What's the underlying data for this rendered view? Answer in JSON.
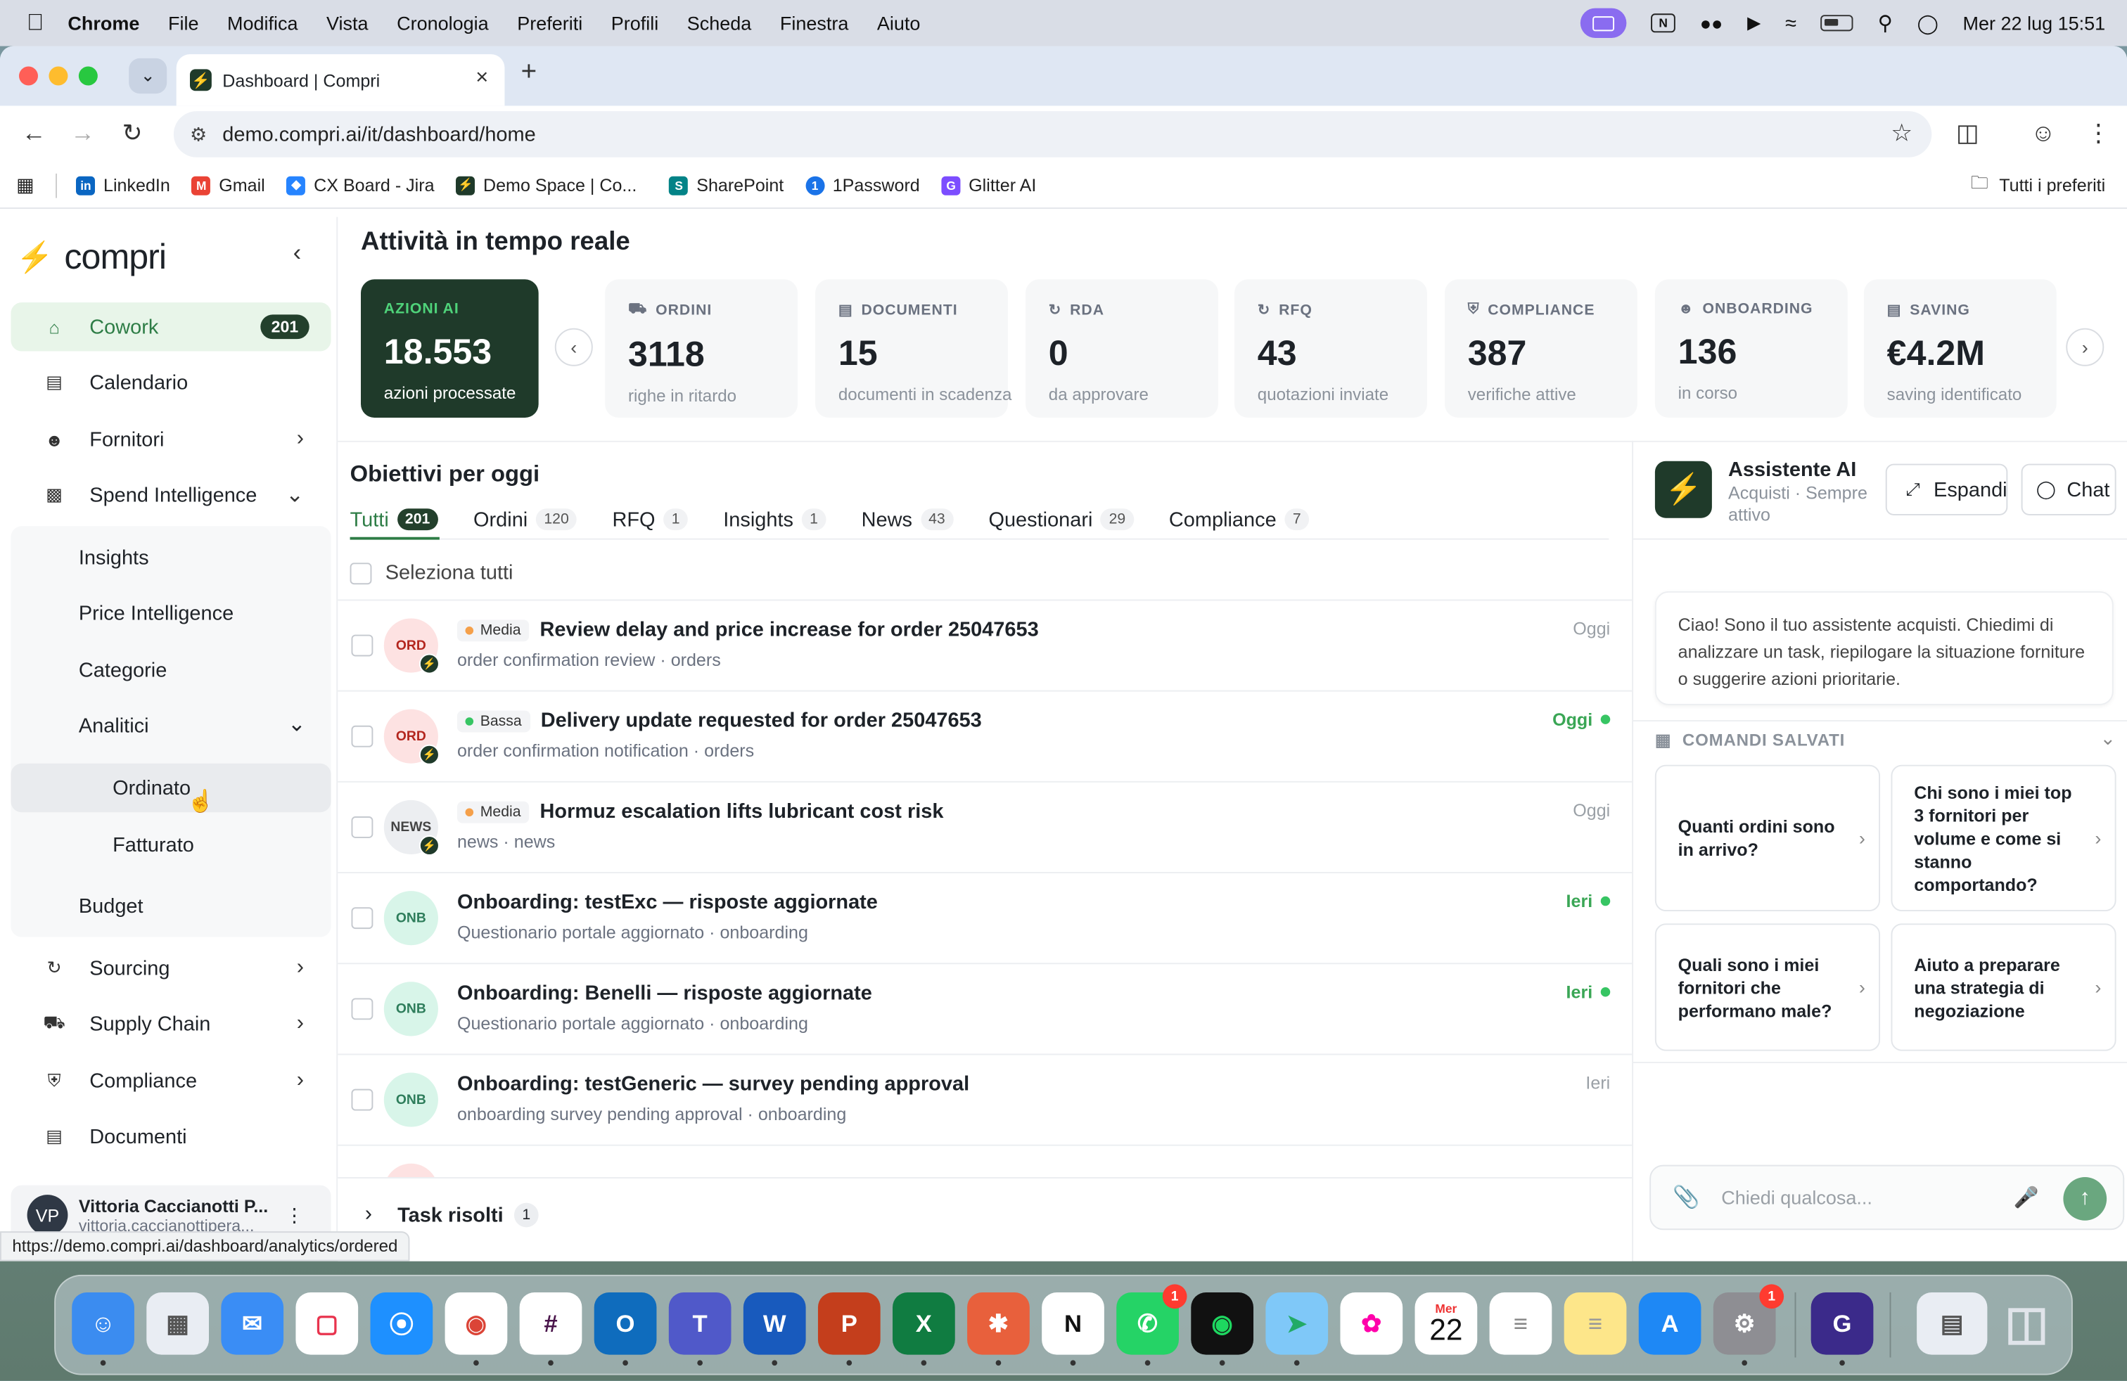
{
  "menubar": {
    "app": "Chrome",
    "items": [
      "File",
      "Modifica",
      "Vista",
      "Cronologia",
      "Preferiti",
      "Profili",
      "Scheda",
      "Finestra",
      "Aiuto"
    ],
    "clock": "Mer 22 lug  15:51"
  },
  "browser": {
    "tab_title": "Dashboard | Compri",
    "url": "demo.compri.ai/it/dashboard/home",
    "bookmarks": [
      "LinkedIn",
      "Gmail",
      "CX Board - Jira",
      "Demo Space | Co...",
      "SharePoint",
      "1Password",
      "Glitter AI"
    ],
    "all_bookmarks": "Tutti i preferiti",
    "status_url": "https://demo.compri.ai/dashboard/analytics/ordered"
  },
  "sidebar": {
    "brand": "compri",
    "cowork": {
      "label": "Cowork",
      "badge": "201"
    },
    "calendario": "Calendario",
    "fornitori": "Fornitori",
    "spend": "Spend Intelligence",
    "insights": "Insights",
    "price": "Price Intelligence",
    "categorie": "Categorie",
    "analitici": "Analitici",
    "ordinato": "Ordinato",
    "fatturato": "Fatturato",
    "budget": "Budget",
    "sourcing": "Sourcing",
    "supply": "Supply Chain",
    "compliance": "Compliance",
    "documenti": "Documenti",
    "user": {
      "initials": "VP",
      "name": "Vittoria Caccianotti P...",
      "email": "vittoria.caccianottipera..."
    }
  },
  "realtime": {
    "title": "Attività in tempo reale",
    "kpis": [
      {
        "label": "AZIONI AI",
        "value": "18.553",
        "caption": "azioni processate"
      },
      {
        "label": "ORDINI",
        "value": "3118",
        "caption": "righe in ritardo"
      },
      {
        "label": "DOCUMENTI",
        "value": "15",
        "caption": "documenti in scadenza"
      },
      {
        "label": "RDA",
        "value": "0",
        "caption": "da approvare"
      },
      {
        "label": "RFQ",
        "value": "43",
        "caption": "quotazioni inviate"
      },
      {
        "label": "COMPLIANCE",
        "value": "387",
        "caption": "verifiche attive"
      },
      {
        "label": "ONBOARDING",
        "value": "136",
        "caption": "in corso"
      },
      {
        "label": "SAVING",
        "value": "€4.2M",
        "caption": "saving identificato"
      }
    ]
  },
  "tasks": {
    "title": "Obiettivi per oggi",
    "tabs": [
      {
        "label": "Tutti",
        "count": "201"
      },
      {
        "label": "Ordini",
        "count": "120"
      },
      {
        "label": "RFQ",
        "count": "1"
      },
      {
        "label": "Insights",
        "count": "1"
      },
      {
        "label": "News",
        "count": "43"
      },
      {
        "label": "Questionari",
        "count": "29"
      },
      {
        "label": "Compliance",
        "count": "7"
      }
    ],
    "select_all": "Seleziona tutti",
    "rows": [
      {
        "tag": "ORD",
        "priority": "Media",
        "title": "Review delay and price increase for order 25047653",
        "subtitle": "order confirmation review · orders",
        "date": "Oggi"
      },
      {
        "tag": "ORD",
        "priority": "Bassa",
        "title": "Delivery update requested for order 25047653",
        "subtitle": "order confirmation notification · orders",
        "date": "Oggi"
      },
      {
        "tag": "NEWS",
        "priority": "Media",
        "title": "Hormuz escalation lifts lubricant cost risk",
        "subtitle": "news · news",
        "date": "Oggi"
      },
      {
        "tag": "ONB",
        "title": "Onboarding: testExc — risposte aggiornate",
        "subtitle": "Questionario portale aggiornato · onboarding",
        "date": "Ieri"
      },
      {
        "tag": "ONB",
        "title": "Onboarding: Benelli — risposte aggiornate",
        "subtitle": "Questionario portale aggiornato · onboarding",
        "date": "Ieri"
      },
      {
        "tag": "ONB",
        "title": "Onboarding: testGeneric — survey pending approval",
        "subtitle": "onboarding survey pending approval · onboarding",
        "date": "Ieri"
      }
    ],
    "resolved": {
      "label": "Task risolti",
      "count": "1"
    }
  },
  "assistant": {
    "name": "Assistente AI",
    "status_line1": "Acquisti · Sempre",
    "status_line2": "attivo",
    "expand": "Espandi",
    "chat": "Chat",
    "greeting": "Ciao! Sono il tuo assistente acquisti. Chiedimi di analizzare un task, riepilogare la situazione forniture o suggerire azioni prioritarie.",
    "saved_title": "COMANDI SALVATI",
    "commands": [
      "Quanti ordini sono in arrivo?",
      "Chi sono i miei top 3 fornitori per volume e come si stanno comportando?",
      "Quali sono i miei fornitori che performano male?",
      "Aiuto a preparare una strategia di negoziazione"
    ],
    "placeholder": "Chiedi qualcosa..."
  },
  "dock": {
    "calendar_day": "Mer",
    "calendar_date": "22",
    "whatsapp_badge": "1",
    "settings_badge": "1"
  },
  "colors": {
    "brand_dark": "#1f3a2a",
    "brand_green": "#37c563",
    "accent_text": "#2e7d46"
  }
}
